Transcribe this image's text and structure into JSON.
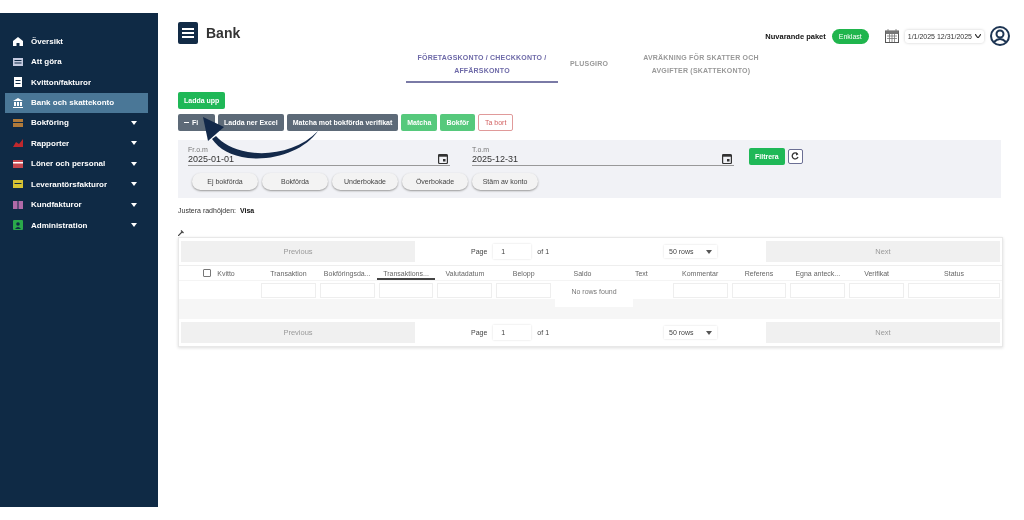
{
  "sidebar": {
    "items": [
      {
        "label": "Översikt",
        "kind": "home",
        "color": "#ffffff",
        "selected": false,
        "expandable": false
      },
      {
        "label": "Att göra",
        "kind": "list",
        "color": "#c5cbe0",
        "selected": false,
        "expandable": false
      },
      {
        "label": "Kvitton/fakturor",
        "kind": "receipt",
        "color": "#ffffff",
        "selected": false,
        "expandable": false
      },
      {
        "label": "Bank och skattekonto",
        "kind": "bank",
        "color": "#ffffff",
        "selected": true,
        "expandable": false
      },
      {
        "label": "Bokföring",
        "kind": "book",
        "color": "#b07a3a",
        "selected": false,
        "expandable": true
      },
      {
        "label": "Rapporter",
        "kind": "chart",
        "color": "#c0282d",
        "selected": false,
        "expandable": true
      },
      {
        "label": "Löner och personal",
        "kind": "people",
        "color": "#c6484f",
        "selected": false,
        "expandable": true
      },
      {
        "label": "Leverantörsfakturor",
        "kind": "invoice",
        "color": "#d6c233",
        "selected": false,
        "expandable": true
      },
      {
        "label": "Kundfakturor",
        "kind": "customer",
        "color": "#b06aa8",
        "selected": false,
        "expandable": true
      },
      {
        "label": "Administration",
        "kind": "admin",
        "color": "#2aa84a",
        "selected": false,
        "expandable": true
      }
    ]
  },
  "header": {
    "title": "Bank",
    "package_label": "Nuvarande paket",
    "package": "Enklast",
    "date_range": "1/1/2025 12/31/2025"
  },
  "tabs": [
    {
      "label": "FÖRETAGSKONTO / CHECKKONTO / AFFÄRSKONTO",
      "selected": true
    },
    {
      "label": "PLUSGIRO",
      "selected": false
    },
    {
      "label": "AVRÄKNING FÖR SKATTER OCH AVGIFTER (SKATTEKONTO)",
      "selected": false
    }
  ],
  "upload_button": "Ladda upp",
  "toolbar": [
    {
      "label": "Fi",
      "kind": "dark"
    },
    {
      "label": "Ladda ner Excel",
      "kind": "dark"
    },
    {
      "label": "Matcha mot bokförda verifikat",
      "kind": "dark"
    },
    {
      "label": "Matcha",
      "kind": "green"
    },
    {
      "label": "Bokför",
      "kind": "green"
    },
    {
      "label": "Ta bort",
      "kind": "outline"
    }
  ],
  "filter": {
    "from_label": "Fr.o.m",
    "from": "2025-01-01",
    "to_label": "T.o.m",
    "to": "2025-12-31",
    "apply": "Filtrera",
    "chips": [
      "Ej bokförda",
      "Bokförda",
      "Underbokade",
      "Överbokade",
      "Stäm av konto"
    ]
  },
  "row_height": {
    "label": "Justera radhöjden:",
    "value": "Visa"
  },
  "table": {
    "pagination_top": {
      "previous": "Previous",
      "page_label": "Page",
      "page": "1",
      "of": "of 1",
      "rows": "50 rows",
      "next": "Next"
    },
    "columns": [
      {
        "label": "Kvitto",
        "checkbox": {
          "checked": false
        },
        "sorted": false,
        "filter": false
      },
      {
        "label": "Transaktion",
        "sorted": false,
        "filter": true
      },
      {
        "label": "Bokföringsda...",
        "sorted": false,
        "filter": true
      },
      {
        "label": "Transaktions...",
        "sorted": true,
        "filter": true
      },
      {
        "label": "Valutadatum",
        "sorted": false,
        "filter": true
      },
      {
        "label": "Belopp",
        "sorted": false,
        "filter": true
      },
      {
        "label": "Saldo",
        "sorted": false,
        "filter": false
      },
      {
        "label": "Text",
        "sorted": false,
        "filter": false
      },
      {
        "label": "Kommentar",
        "sorted": false,
        "filter": true
      },
      {
        "label": "Referens",
        "sorted": false,
        "filter": true
      },
      {
        "label": "Egna anteck...",
        "sorted": false,
        "filter": true
      },
      {
        "label": "Verifikat",
        "sorted": false,
        "filter": true
      },
      {
        "label": "Status",
        "sorted": false,
        "filter": true
      }
    ],
    "empty": "No rows found",
    "pagination_bottom": {
      "previous": "Previous",
      "page_label": "Page",
      "page": "1",
      "of": "of 1",
      "rows": "50 rows",
      "next": "Next"
    }
  }
}
